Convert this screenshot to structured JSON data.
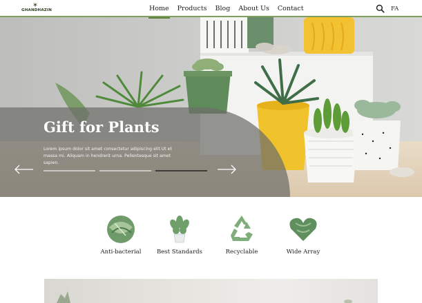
{
  "header": {
    "logo_text": "GHANDHAZIN",
    "nav": [
      {
        "label": "Home",
        "active": true
      },
      {
        "label": "Products",
        "active": false
      },
      {
        "label": "Blog",
        "active": false
      },
      {
        "label": "About Us",
        "active": false
      },
      {
        "label": "Contact",
        "active": false
      }
    ],
    "search_icon": "search-icon",
    "language": "FA",
    "accent_color": "#7fa05a"
  },
  "hero": {
    "title": "Gift for Plants",
    "text": "Lorem ipsum dolor sit amet consectetur adipiscing elit Ut et massa mi. Aliquam in hendrerit urna. Pellentesque sit amet sapien.",
    "prev_icon": "arrow-left-icon",
    "next_icon": "arrow-right-icon",
    "slide_count": 4,
    "active_slide": 3
  },
  "features": [
    {
      "label": "Anti-bacterial",
      "icon": "leaf-bowl-icon"
    },
    {
      "label": "Best Standards",
      "icon": "potted-succulent-icon"
    },
    {
      "label": "Recyclable",
      "icon": "recycle-icon"
    },
    {
      "label": "Wide Array",
      "icon": "leaf-heart-icon"
    }
  ]
}
